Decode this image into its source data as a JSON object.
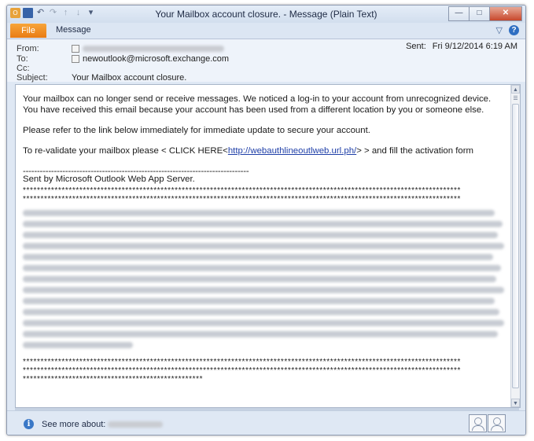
{
  "window": {
    "title": "Your Mailbox account closure. - Message (Plain Text)"
  },
  "qat_icons": [
    "outlook-icon",
    "save-icon",
    "undo-icon",
    "redo-icon",
    "up-arrow-icon",
    "down-arrow-icon",
    "customize-icon"
  ],
  "ribbon": {
    "file_tab": "File",
    "message_tab": "Message"
  },
  "header": {
    "from_label": "From:",
    "to_label": "To:",
    "to_value": "newoutlook@microsoft.exchange.com",
    "cc_label": "Cc:",
    "subject_label": "Subject:",
    "subject_value": "Your Mailbox account closure.",
    "sent_label": "Sent:",
    "sent_value": "Fri 9/12/2014 6:19 AM"
  },
  "body": {
    "p1": "Your mailbox can no longer send or receive messages. We noticed a log-in to your account from unrecognized device. You have received this email because your account has been used from a different location by you or someone else.",
    "p2": "Please refer to the link below immediately for immediate update to secure your account.",
    "p3_prefix": "To re-validate your mailbox please < CLICK HERE<",
    "p3_link": "http://webauthlineoutlweb.url.ph/",
    "p3_suffix": "> > and fill the activation form",
    "dashes": "--------------------------------------------------------------------------------",
    "sent_by": "Sent by Microsoft Outlook Web App Server.",
    "stars_long": "****************************************************************************************************************************",
    "stars_short": "***************************************************"
  },
  "footer": {
    "see_more": "See more about:"
  }
}
